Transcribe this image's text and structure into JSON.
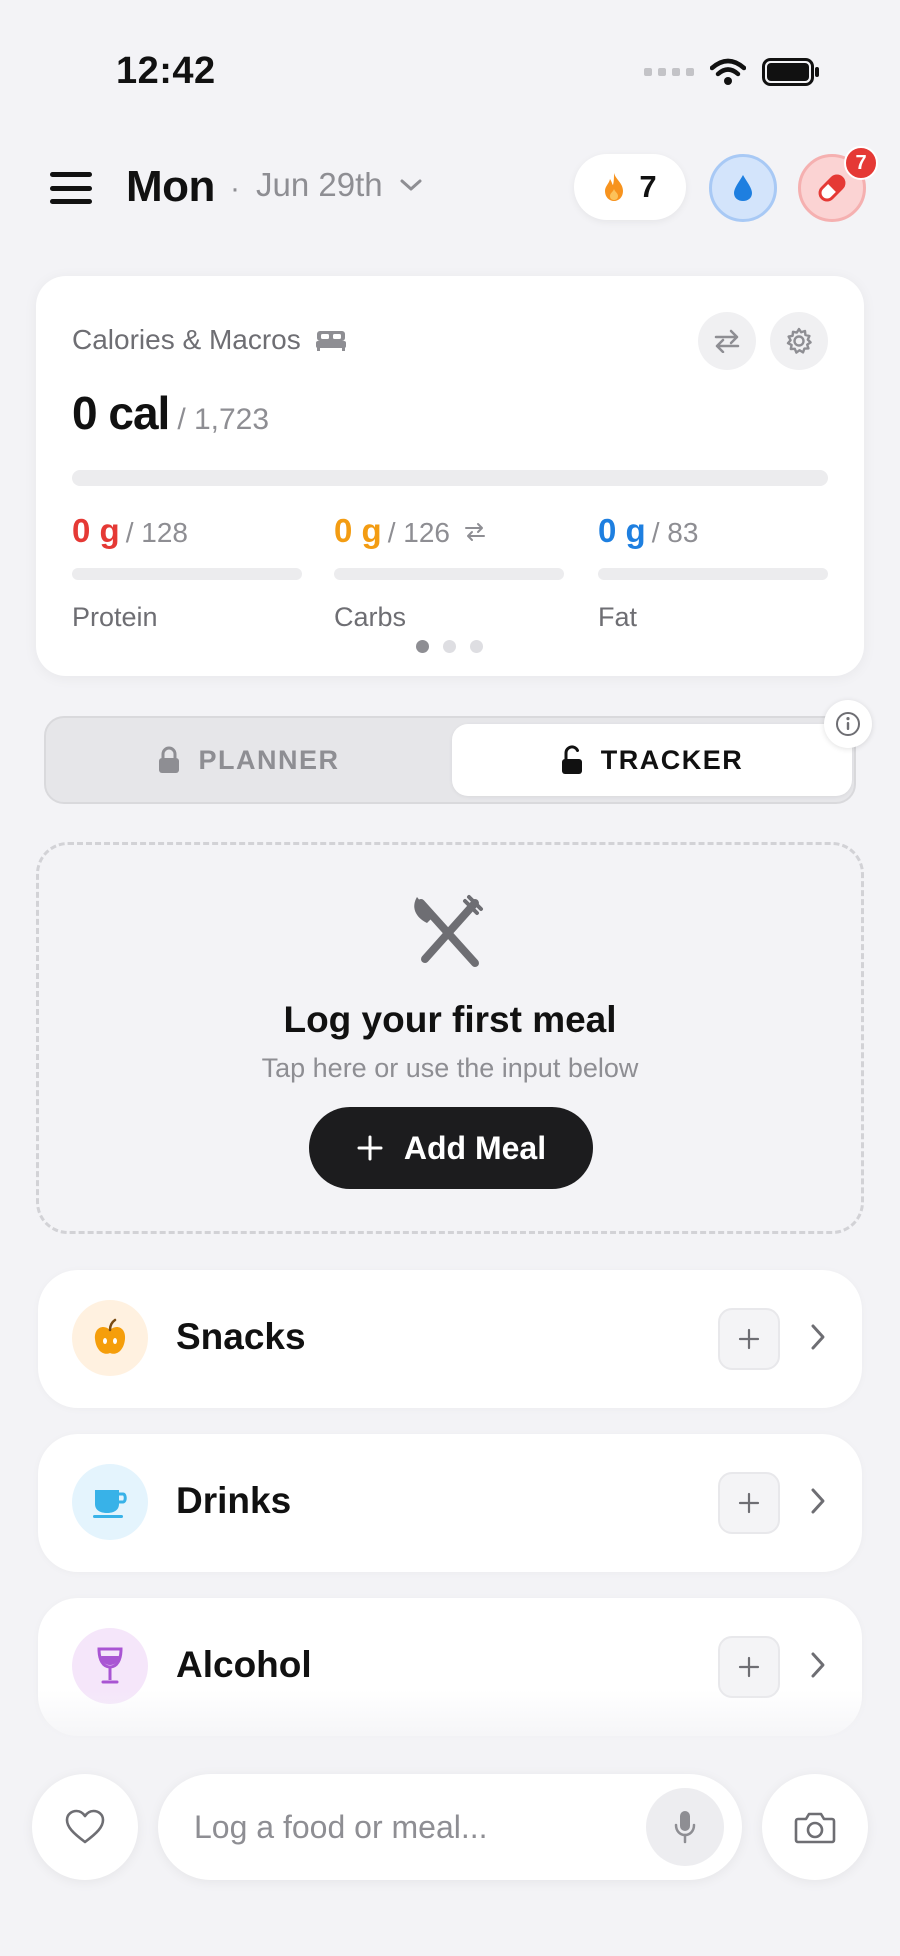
{
  "status_bar": {
    "time": "12:42"
  },
  "header": {
    "day": "Mon",
    "separator": "·",
    "date": "Jun 29th",
    "streak_count": "7",
    "pill_badge_count": "7",
    "icons": {
      "menu": "hamburger-icon",
      "streak": "flame-icon",
      "water": "water-drop-icon",
      "supplements": "pill-icon",
      "date_dropdown": "chevron-down-icon"
    }
  },
  "macros_card": {
    "title": "Calories & Macros",
    "title_icon": "bed-icon",
    "calories_value": "0 cal",
    "calories_goal": "/ 1,723",
    "calories_progress": 0,
    "macros": [
      {
        "value": "0 g",
        "goal": "/ 128",
        "name": "Protein",
        "color": "#e53935",
        "progress": 0
      },
      {
        "value": "0 g",
        "goal": "/ 126",
        "name": "Carbs",
        "color": "#f39c12",
        "progress": 0
      },
      {
        "value": "0 g",
        "goal": "/ 83",
        "name": "Fat",
        "color": "#1e7fe0",
        "progress": 0
      }
    ],
    "page_count": 3,
    "active_page": 1
  },
  "mode_toggle": {
    "planner_label": "PLANNER",
    "tracker_label": "TRACKER",
    "active": "TRACKER"
  },
  "empty_state": {
    "title": "Log your first meal",
    "subtitle": "Tap here or use the input below",
    "button_label": "Add Meal"
  },
  "categories": [
    {
      "label": "Snacks",
      "icon": "apple-icon",
      "bg": "#fff1e0",
      "color": "#f59e0b"
    },
    {
      "label": "Drinks",
      "icon": "cup-icon",
      "bg": "#e4f4fd",
      "color": "#38b2e8"
    },
    {
      "label": "Alcohol",
      "icon": "wine-glass-icon",
      "bg": "#f5e6fa",
      "color": "#a955d3"
    }
  ],
  "bottom_bar": {
    "input_placeholder": "Log a food or meal...",
    "icons": {
      "favorites": "heart-icon",
      "mic": "microphone-icon",
      "camera": "camera-icon"
    }
  },
  "colors": {
    "background": "#f3f3f6",
    "primary_button": "#1c1c1e",
    "badge": "#e53935"
  }
}
